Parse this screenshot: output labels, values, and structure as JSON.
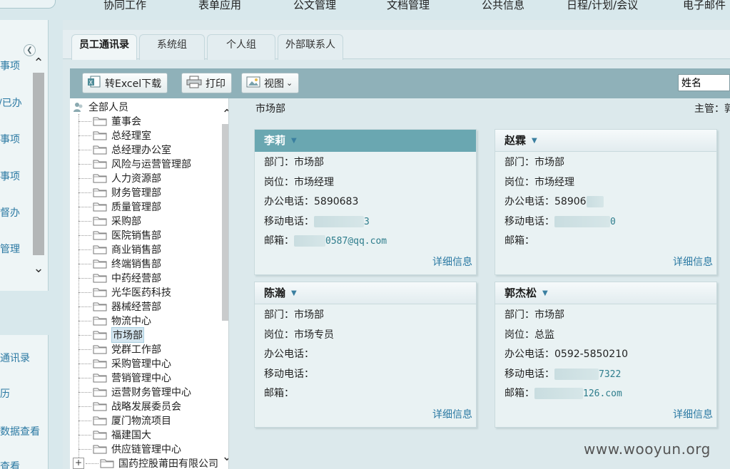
{
  "top_nav": [
    "协同工作",
    "表单应用",
    "公文管理",
    "文档管理",
    "公共信息",
    "日程/计划/会议",
    "电子邮件"
  ],
  "left_menu": {
    "collapse_icon": "chevron-left-icon",
    "items": [
      "事项",
      "/已办",
      "事项",
      "事项",
      "督办",
      "管理"
    ],
    "items2": [
      "通讯录",
      "历",
      "数据查看",
      "查看"
    ]
  },
  "tabs": [
    "员工通讯录",
    "系统组",
    "个人组",
    "外部联系人"
  ],
  "toolbar": {
    "export_label": "转Excel下载",
    "print_label": "打印",
    "view_label": "视图",
    "search_value": "姓名"
  },
  "tree": {
    "root": "全部人员",
    "items": [
      "董事会",
      "总经理室",
      "总经理办公室",
      "风险与运营管理部",
      "人力资源部",
      "财务管理部",
      "质量管理部",
      "采购部",
      "医院销售部",
      "商业销售部",
      "终端销售部",
      "中药经营部",
      "光华医药科技",
      "器械经营部",
      "物流中心",
      "市场部",
      "党群工作部",
      "采购管理中心",
      "营销管理中心",
      "运营财务管理中心",
      "战略发展委员会",
      "厦门物流项目",
      "福建国大",
      "供应链管理中心",
      "国药控股莆田有限公司"
    ],
    "selected": "市场部"
  },
  "dept": {
    "title": "市场部",
    "manager": "主管：郭"
  },
  "labels": {
    "dept": "部门：",
    "post": "岗位：",
    "office": "办公电话：",
    "mobile": "移动电话：",
    "email": "邮箱：",
    "detail": "详细信息"
  },
  "cards": [
    {
      "name": "李莉",
      "dept": "市场部",
      "post": "市场经理",
      "office": "5890683",
      "mobile": "3",
      "email": "0587@qq.com"
    },
    {
      "name": "赵霖",
      "dept": "市场部",
      "post": "市场经理",
      "office": "58906",
      "mobile": "0",
      "email": ""
    },
    {
      "name": "陈瀚",
      "dept": "市场部",
      "post": "市场专员",
      "office": "",
      "mobile": "",
      "email": ""
    },
    {
      "name": "郭杰松",
      "dept": "市场部",
      "post": "总监",
      "office": "0592-5850210",
      "mobile": "7322",
      "email": "126.com"
    }
  ],
  "watermark": "www.wooyun.org"
}
